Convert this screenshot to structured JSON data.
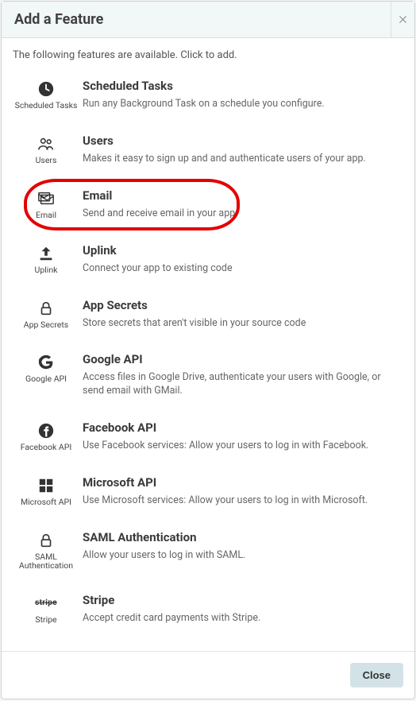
{
  "header": {
    "title": "Add a Feature"
  },
  "intro": "The following features are available. Click to add.",
  "features": [
    {
      "icon": "clock-icon",
      "icon_label": "Scheduled Tasks",
      "title": "Scheduled Tasks",
      "desc": "Run any Background Task on a schedule you configure.",
      "highlighted": false
    },
    {
      "icon": "users-icon",
      "icon_label": "Users",
      "title": "Users",
      "desc": "Makes it easy to sign up and and authenticate users of your app.",
      "highlighted": false
    },
    {
      "icon": "email-icon",
      "icon_label": "Email",
      "title": "Email",
      "desc": "Send and receive email in your app.",
      "highlighted": true
    },
    {
      "icon": "uplink-icon",
      "icon_label": "Uplink",
      "title": "Uplink",
      "desc": "Connect your app to existing code",
      "highlighted": false
    },
    {
      "icon": "lock-icon",
      "icon_label": "App Secrets",
      "title": "App Secrets",
      "desc": "Store secrets that aren't visible in your source code",
      "highlighted": false
    },
    {
      "icon": "google-icon",
      "icon_label": "Google API",
      "title": "Google API",
      "desc": "Access files in Google Drive, authenticate your users with Google, or send email with GMail.",
      "highlighted": false
    },
    {
      "icon": "facebook-icon",
      "icon_label": "Facebook API",
      "title": "Facebook API",
      "desc": "Use Facebook services: Allow your users to log in with Facebook.",
      "highlighted": false
    },
    {
      "icon": "microsoft-icon",
      "icon_label": "Microsoft API",
      "title": "Microsoft API",
      "desc": "Use Microsoft services: Allow your users to log in with Microsoft.",
      "highlighted": false
    },
    {
      "icon": "saml-icon",
      "icon_label": "SAML Authentication",
      "title": "SAML Authentication",
      "desc": "Allow your users to log in with SAML.",
      "highlighted": false
    },
    {
      "icon": "stripe-icon",
      "icon_label": "Stripe",
      "title": "Stripe",
      "desc": "Accept credit card payments with Stripe.",
      "highlighted": false
    }
  ],
  "footer": {
    "close_label": "Close"
  }
}
